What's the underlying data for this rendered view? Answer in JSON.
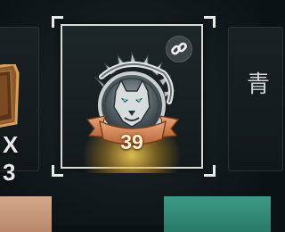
{
  "left_card": {
    "quantity": "X 3",
    "item_icon": "shield-item-icon"
  },
  "right_card": {
    "glyph": "青"
  },
  "selected_card": {
    "emblem_icon": "wolf-emblem-icon",
    "level": "39",
    "link_icon": "link-icon"
  },
  "colors": {
    "frame": "#d8dbd6",
    "ribbon": "#d98a5a",
    "glow": "#ffd85a",
    "strip_left": "#d3a98a",
    "strip_right": "#3d9a86"
  }
}
